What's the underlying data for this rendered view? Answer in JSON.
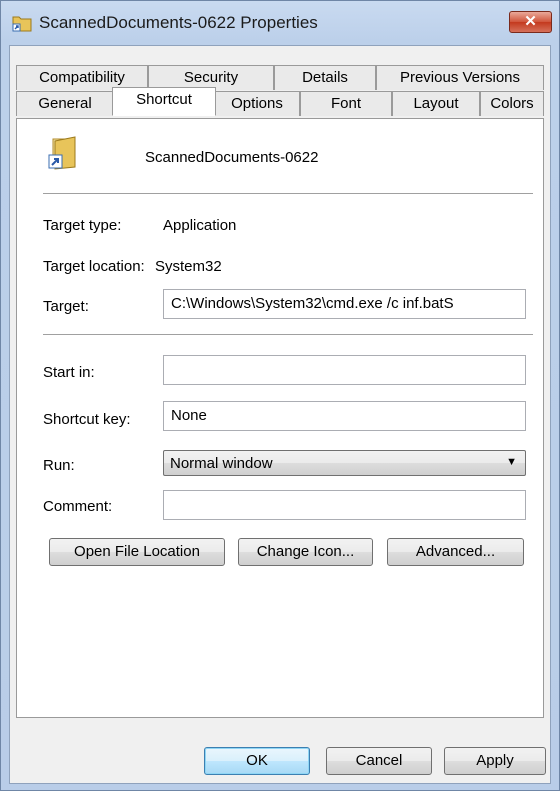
{
  "window": {
    "title": "ScannedDocuments-0622 Properties",
    "close_glyph": "✕",
    "accent": "#3c7fb1",
    "close_color": "#c3391e"
  },
  "tabs": {
    "row1": [
      "Compatibility",
      "Security",
      "Details",
      "Previous Versions"
    ],
    "row2": [
      "General",
      "Shortcut",
      "Options",
      "Font",
      "Layout",
      "Colors"
    ],
    "active": "Shortcut"
  },
  "shortcut": {
    "icon": "folder-shortcut-icon",
    "name": "ScannedDocuments-0622",
    "target_type_label": "Target type:",
    "target_type_value": "Application",
    "target_location_label": "Target location:",
    "target_location_value": "System32",
    "target_label": "Target:",
    "target_value": "C:\\Windows\\System32\\cmd.exe /c inf.batS",
    "start_in_label": "Start in:",
    "start_in_value": "",
    "shortcut_key_label": "Shortcut key:",
    "shortcut_key_value": "None",
    "run_label": "Run:",
    "run_value": "Normal window",
    "comment_label": "Comment:",
    "comment_value": "",
    "buttons": {
      "open_file_location": "Open File Location",
      "change_icon": "Change Icon...",
      "advanced": "Advanced..."
    }
  },
  "footer": {
    "ok": "OK",
    "cancel": "Cancel",
    "apply": "Apply"
  }
}
